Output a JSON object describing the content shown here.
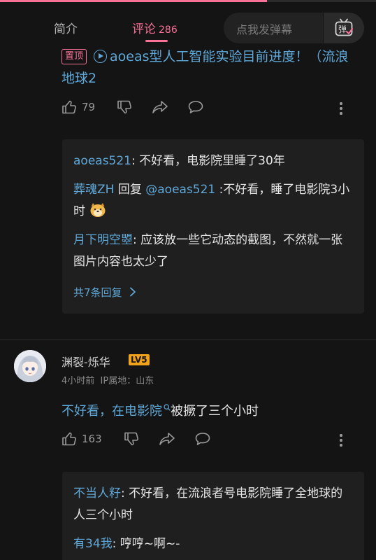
{
  "progress_fraction": 0.71,
  "tabs": {
    "intro": "简介",
    "comments": "评论",
    "comments_count": "286"
  },
  "danmaku": {
    "placeholder": "点我发弹幕",
    "button_icon": "danmaku-toggle-icon"
  },
  "pinned": {
    "badge": "置顶",
    "text": "aoeas型人工智能实验目前进度！（流浪地球2",
    "likes": "79"
  },
  "replies_1": [
    {
      "user": "aoeas521",
      "text": ": 不好看，电影院里睡了30年"
    },
    {
      "user": "葬魂ZH",
      "mid": " 回复 ",
      "mention": "@aoeas521",
      "text": " :不好看，睡了电影院3小时"
    },
    {
      "user": "月下明空曌",
      "text": ": 应该放一些它动态的截图，不然就一张图片内容也太少了"
    }
  ],
  "replies_1_more": "共7条回复",
  "comment": {
    "author": "渊裂-烁华",
    "level": "LV5",
    "time": "4小时前",
    "ip": "IP属地：山东",
    "link_text": "不好看，在电影院",
    "text": "被撅了三个小时",
    "likes": "163"
  },
  "replies_2": [
    {
      "user": "不当人籽",
      "text": ": 不好看，在流浪者号电影院睡了全地球的人三个小时"
    },
    {
      "user": "有34我",
      "text": ": 哼哼~啊~-"
    }
  ],
  "colors": {
    "accent": "#fb7299",
    "link": "#5fa8d8",
    "level": "#f0a21b",
    "bg": "#141414"
  }
}
